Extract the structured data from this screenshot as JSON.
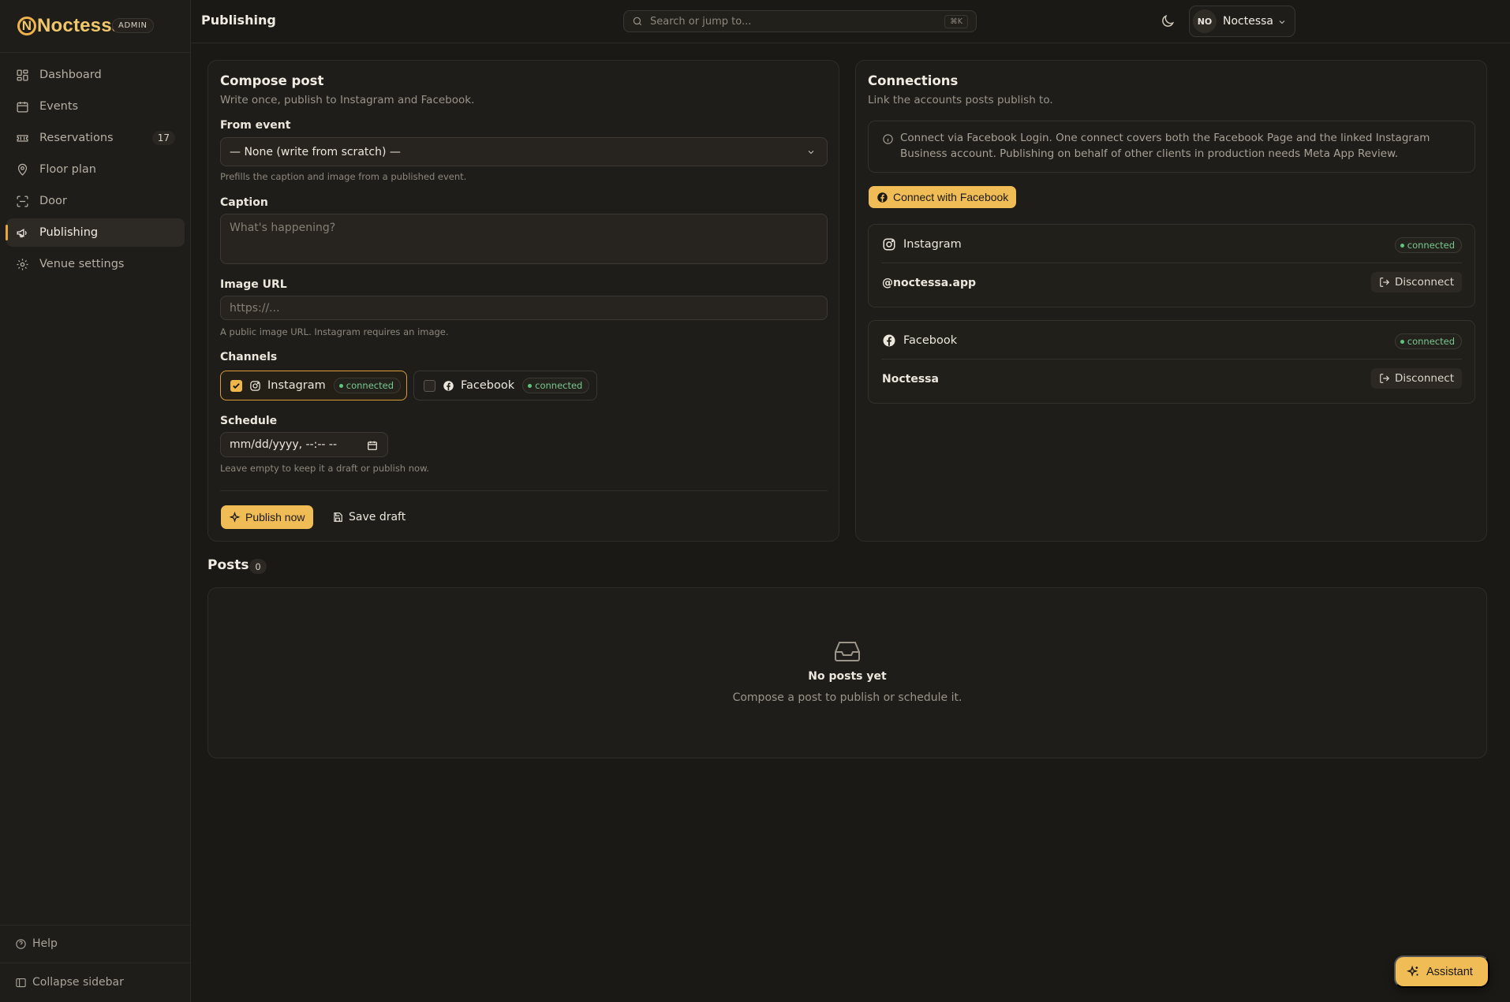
{
  "brand": {
    "name": "Noctessa",
    "badge": "ADMIN"
  },
  "sidebar": {
    "items": [
      {
        "label": "Dashboard",
        "icon": "dashboard-icon"
      },
      {
        "label": "Events",
        "icon": "calendar-icon"
      },
      {
        "label": "Reservations",
        "icon": "ticket-icon",
        "count": "17"
      },
      {
        "label": "Floor plan",
        "icon": "map-pin-icon"
      },
      {
        "label": "Door",
        "icon": "scan-icon"
      },
      {
        "label": "Publishing",
        "icon": "megaphone-icon",
        "active": true
      },
      {
        "label": "Venue settings",
        "icon": "gear-icon"
      }
    ],
    "help": "Help",
    "collapse": "Collapse sidebar"
  },
  "header": {
    "title": "Publishing",
    "search_placeholder": "Search or jump to...",
    "search_shortcut": "⌘K",
    "account": {
      "initials": "NO",
      "name": "Noctessa"
    }
  },
  "compose": {
    "title": "Compose post",
    "subtitle": "Write once, publish to Instagram and Facebook.",
    "from_event": {
      "label": "From event",
      "value": "— None (write from scratch) —",
      "help": "Prefills the caption and image from a published event."
    },
    "caption": {
      "label": "Caption",
      "placeholder": "What's happening?"
    },
    "image_url": {
      "label": "Image URL",
      "placeholder": "https://...",
      "help": "A public image URL. Instagram requires an image."
    },
    "channels": {
      "label": "Channels",
      "items": [
        {
          "name": "Instagram",
          "status": "connected",
          "checked": true
        },
        {
          "name": "Facebook",
          "status": "connected",
          "checked": false
        }
      ]
    },
    "schedule": {
      "label": "Schedule",
      "placeholder": "mm/dd/yyyy, --:-- --",
      "help": "Leave empty to keep it a draft or publish now."
    },
    "publish_label": "Publish now",
    "draft_label": "Save draft"
  },
  "connections": {
    "title": "Connections",
    "subtitle": "Link the accounts posts publish to.",
    "info": "Connect via Facebook Login. One connect covers both the Facebook Page and the linked Instagram Business account. Publishing on behalf of other clients in production needs Meta App Review.",
    "connect_label": "Connect with Facebook",
    "accounts": [
      {
        "platform": "Instagram",
        "status": "connected",
        "handle": "@noctessa.app",
        "action": "Disconnect"
      },
      {
        "platform": "Facebook",
        "status": "connected",
        "handle": "Noctessa",
        "action": "Disconnect"
      }
    ]
  },
  "posts": {
    "title": "Posts",
    "count": "0",
    "empty_title": "No posts yet",
    "empty_subtitle": "Compose a post to publish or schedule it."
  },
  "assistant_label": "Assistant",
  "colors": {
    "accent": "#f0bc55",
    "background": "#1b1915",
    "status_connected": "#5ec47c"
  }
}
